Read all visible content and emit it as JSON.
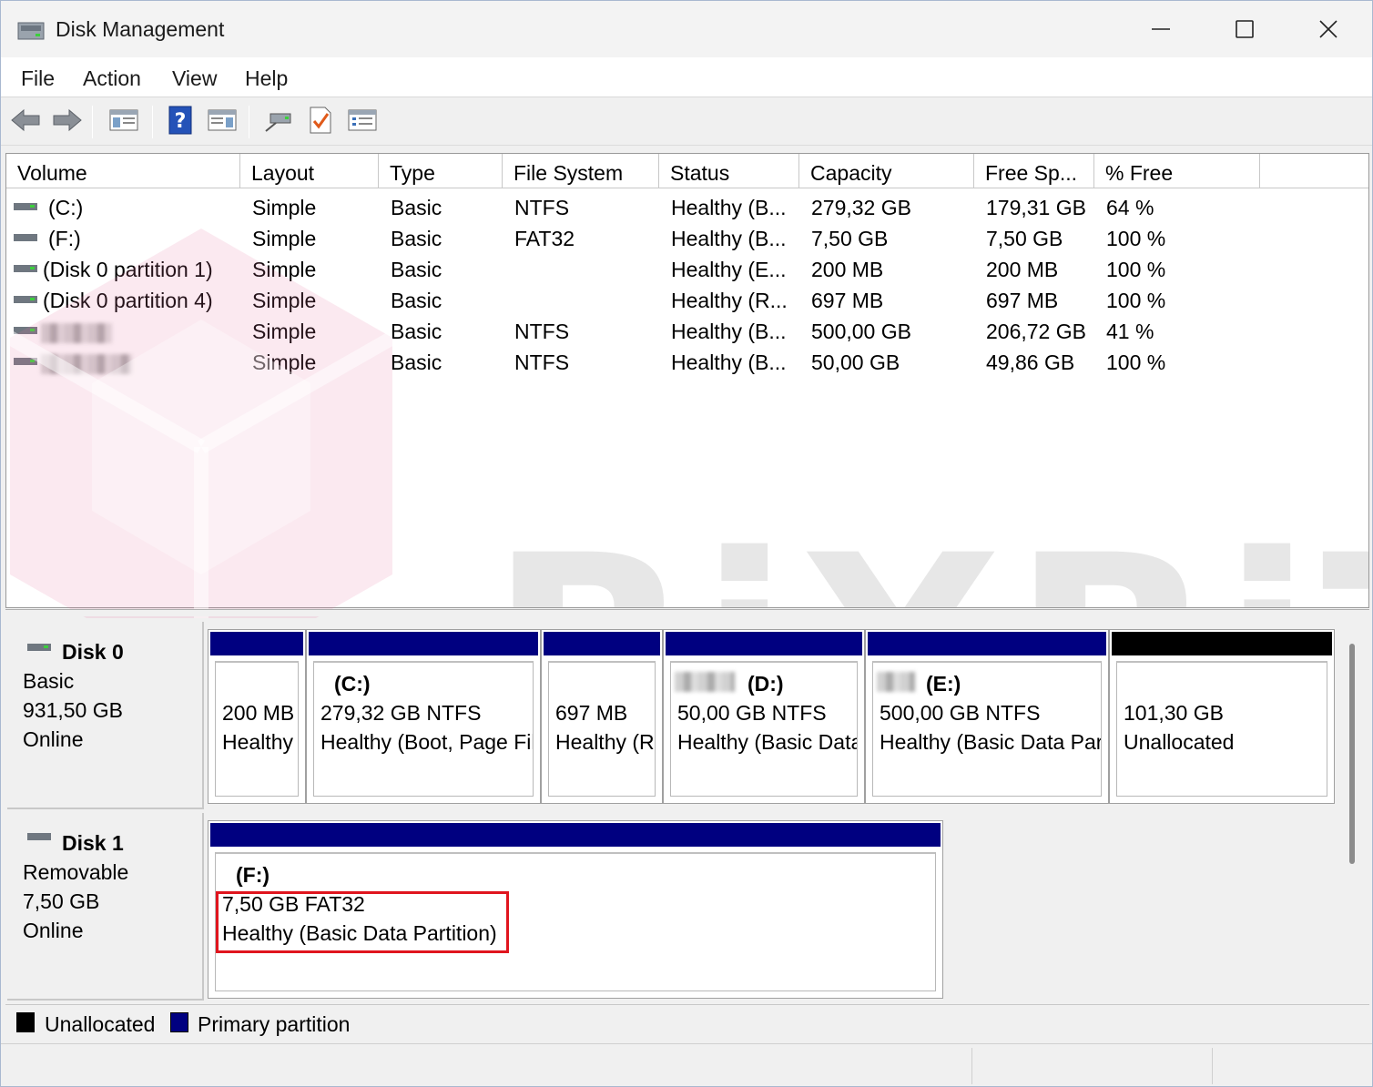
{
  "window": {
    "title": "Disk Management",
    "app_icon": "disk-management-icon",
    "controls": [
      "minimize-icon",
      "maximize-icon",
      "close-icon"
    ]
  },
  "menu": {
    "file": "File",
    "action": "Action",
    "view": "View",
    "help": "Help"
  },
  "toolbar": {
    "icons": [
      "back-arrow-icon",
      "forward-arrow-icon",
      "show-hide-console-tree-icon",
      "help-icon",
      "show-hide-action-pane-icon",
      "connect-virtual-disk-icon",
      "check-properties-icon",
      "list-view-icon"
    ]
  },
  "columns": {
    "volume": "Volume",
    "layout": "Layout",
    "type": "Type",
    "filesystem": "File System",
    "status": "Status",
    "capacity": "Capacity",
    "free": "Free Sp...",
    "pct": "% Free"
  },
  "volumes": [
    {
      "volume": "(C:)",
      "layout": "Simple",
      "type": "Basic",
      "fs": "NTFS",
      "status": "Healthy (B...",
      "capacity": "279,32 GB",
      "free": "179,31 GB",
      "pct": "64 %"
    },
    {
      "volume": "(F:)",
      "layout": "Simple",
      "type": "Basic",
      "fs": "FAT32",
      "status": "Healthy (B...",
      "capacity": "7,50 GB",
      "free": "7,50 GB",
      "pct": "100 %"
    },
    {
      "volume": "(Disk 0 partition 1)",
      "layout": "Simple",
      "type": "Basic",
      "fs": "",
      "status": "Healthy (E...",
      "capacity": "200 MB",
      "free": "200 MB",
      "pct": "100 %"
    },
    {
      "volume": "(Disk 0 partition 4)",
      "layout": "Simple",
      "type": "Basic",
      "fs": "",
      "status": "Healthy (R...",
      "capacity": "697 MB",
      "free": "697 MB",
      "pct": "100 %"
    },
    {
      "volume": "",
      "layout": "Simple",
      "type": "Basic",
      "fs": "NTFS",
      "status": "Healthy (B...",
      "capacity": "500,00 GB",
      "free": "206,72 GB",
      "pct": "41 %"
    },
    {
      "volume": "",
      "layout": "Simple",
      "type": "Basic",
      "fs": "NTFS",
      "status": "Healthy (B...",
      "capacity": "50,00 GB",
      "free": "49,86 GB",
      "pct": "100 %"
    }
  ],
  "watermark": "BiXBiT",
  "disk0": {
    "name": "Disk 0",
    "type": "Basic",
    "size": "931,50 GB",
    "state": "Online",
    "partitions": [
      {
        "title": "",
        "line1": "200 MB",
        "line2": "Healthy (EFI System Partition)"
      },
      {
        "title": "(C:)",
        "line1": "279,32 GB NTFS",
        "line2": "Healthy (Boot, Page File, Crash Dump, Basic Data Partition)"
      },
      {
        "title": "",
        "line1": "697 MB",
        "line2": "Healthy (Recovery Partition)"
      },
      {
        "title": "(D:)",
        "line1": "50,00 GB NTFS",
        "line2": "Healthy (Basic Data Partition)"
      },
      {
        "title": "(E:)",
        "line1": "500,00 GB NTFS",
        "line2": "Healthy (Basic Data Partition)"
      },
      {
        "title": "",
        "line1": "101,30 GB",
        "line2": "Unallocated"
      }
    ]
  },
  "disk1": {
    "name": "Disk 1",
    "type": "Removable",
    "size": "7,50 GB",
    "state": "Online",
    "partition": {
      "title": "(F:)",
      "line1": "7,50 GB  FAT32",
      "line2": "Healthy (Basic Data Partition)"
    }
  },
  "legend": {
    "unallocated": "Unallocated",
    "primary": "Primary partition",
    "unallocated_color": "#000000",
    "primary_color": "#000080"
  },
  "colors": {
    "partition_bar": "#000080",
    "highlight_box": "#e0151e"
  }
}
